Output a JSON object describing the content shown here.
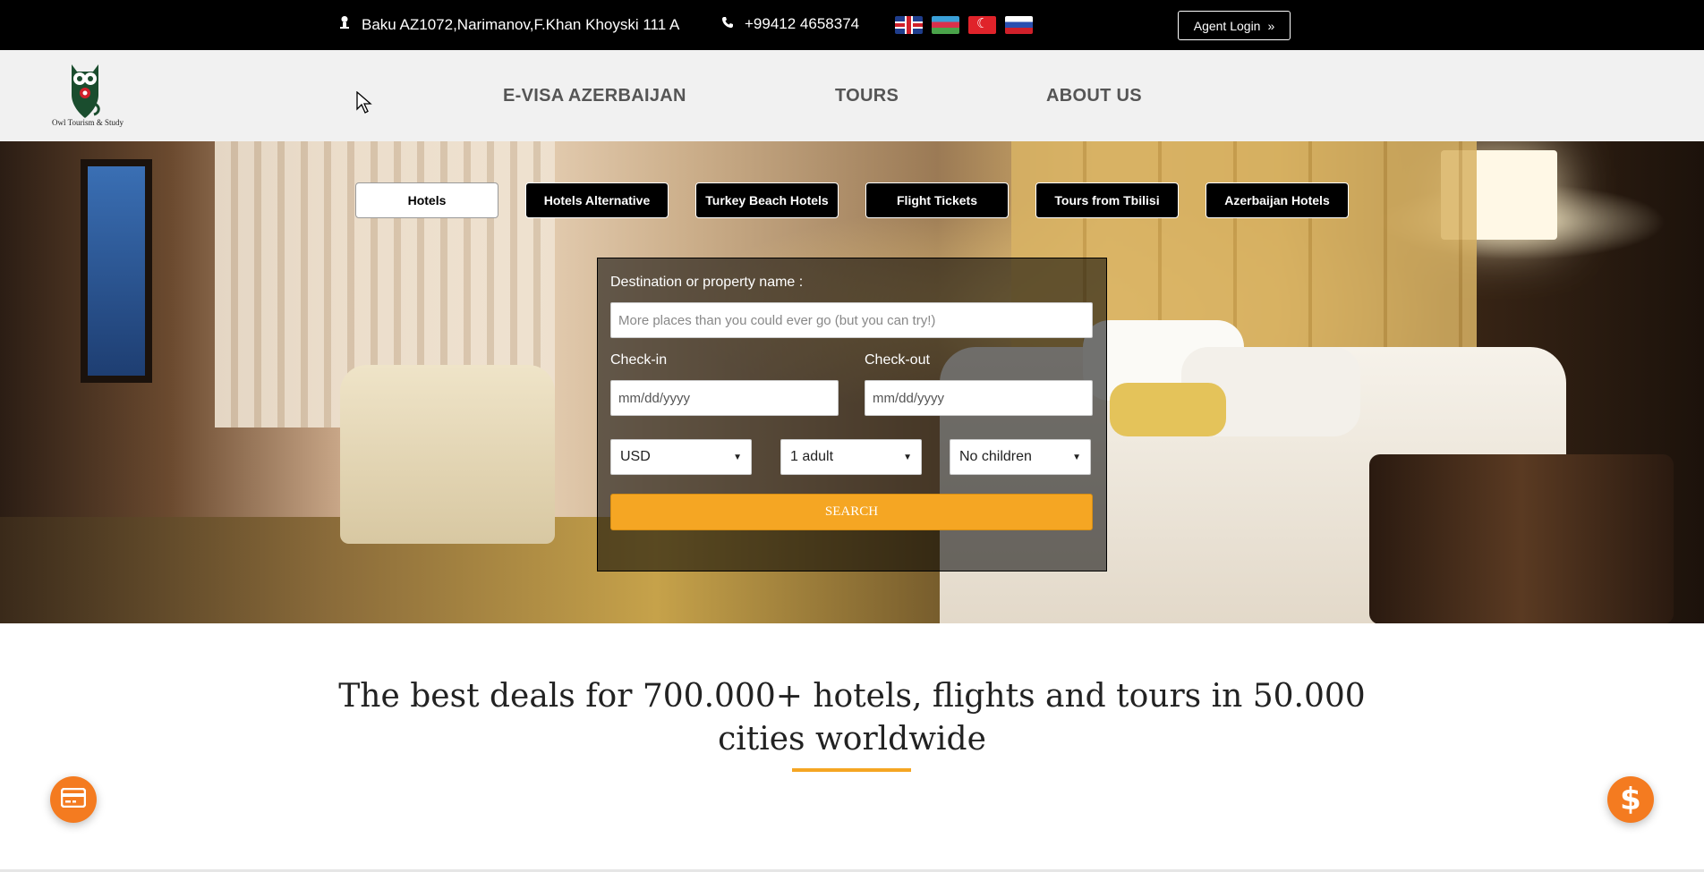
{
  "topbar": {
    "address": "Baku AZ1072,Narimanov,F.Khan Khoyski 111 A",
    "phone": "+99412 4658374",
    "flags": [
      "flag-uk",
      "flag-az",
      "flag-tr",
      "flag-ru"
    ],
    "agent_login": "Agent Login"
  },
  "brand": {
    "logo_text": "Owl Tourism & Study"
  },
  "nav": {
    "items": [
      "E-VISA AZERBAIJAN",
      "TOURS",
      "ABOUT US"
    ]
  },
  "tabs": [
    "Hotels",
    "Hotels Alternative",
    "Turkey Beach Hotels",
    "Flight Tickets",
    "Tours from Tbilisi",
    "Azerbaijan Hotels"
  ],
  "search": {
    "destination_label": "Destination or property name :",
    "destination_placeholder": "More places than you could ever go (but you can try!)",
    "checkin_label": "Check-in",
    "checkin_value": "mm/dd/yyyy",
    "checkout_label": "Check-out",
    "checkout_value": "mm/dd/yyyy",
    "currency": "USD",
    "adults": "1 adult",
    "children": "No children",
    "button": "SEARCH"
  },
  "headline": {
    "line1": "The best deals for 700.000+ hotels, flights and tours in 50.000",
    "line2": "cities worldwide"
  },
  "colors": {
    "accent": "#f5a623",
    "fab": "#f47b20",
    "topbar": "#000000"
  }
}
